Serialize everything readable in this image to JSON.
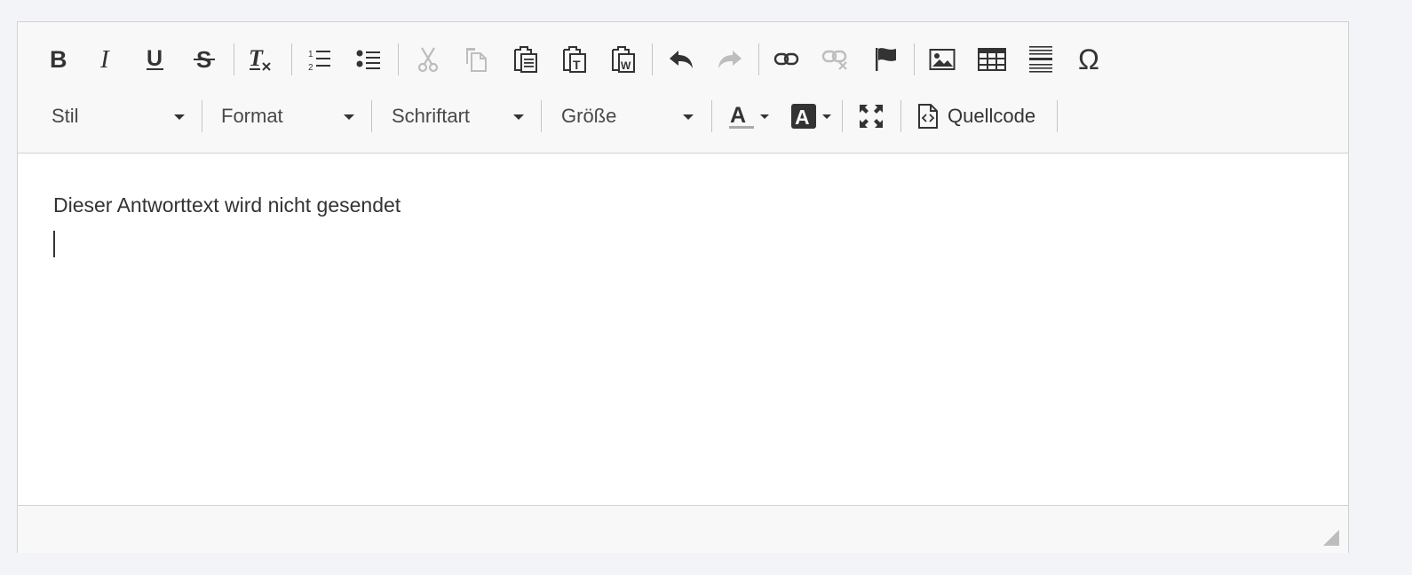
{
  "toolbar": {
    "row1": {
      "icons": [
        "bold-icon",
        "italic-icon",
        "underline-icon",
        "strikethrough-icon",
        "remove-format-icon",
        "numbered-list-icon",
        "bulleted-list-icon",
        "cut-icon",
        "copy-icon",
        "paste-icon",
        "paste-text-icon",
        "paste-word-icon",
        "undo-icon",
        "redo-icon",
        "link-icon",
        "unlink-icon",
        "anchor-flag-icon",
        "image-icon",
        "table-icon",
        "horizontal-line-icon",
        "special-char-icon"
      ]
    },
    "row2": {
      "style_label": "Stil",
      "format_label": "Format",
      "font_label": "Schriftart",
      "size_label": "Größe",
      "source_label": "Quellcode"
    },
    "colors": {
      "icon": "#333333",
      "icon_disabled": "#bdbdbd",
      "text_color_underline": "#aaaaaa"
    }
  },
  "content": {
    "text": "Dieser Antworttext wird nicht gesendet"
  }
}
